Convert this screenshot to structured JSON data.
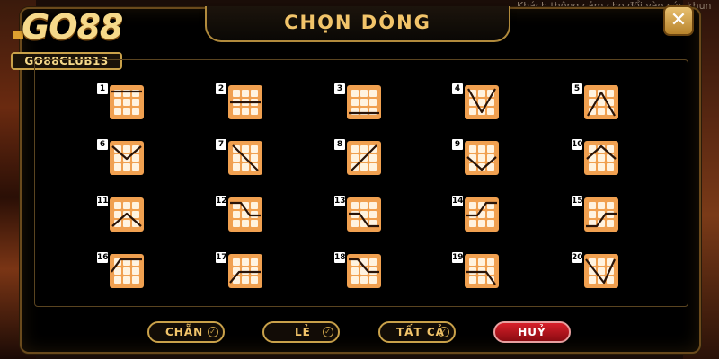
{
  "background": {
    "top_text": "Khách thông cảm cho đổi vào các khun"
  },
  "logo": {
    "main": "GO88",
    "sub": "GO88CLUB13"
  },
  "dialog": {
    "title": "CHỌN DÒNG",
    "close_label": "✕",
    "colors": {
      "accent": "#f2c46a",
      "icon_fill": "#f0a050",
      "line": "#2a1408",
      "frame": "#c9a14a"
    }
  },
  "lines": [
    {
      "number": "1",
      "pattern": "row-top"
    },
    {
      "number": "2",
      "pattern": "row-middle"
    },
    {
      "number": "3",
      "pattern": "row-bottom"
    },
    {
      "number": "4",
      "pattern": "v-down"
    },
    {
      "number": "5",
      "pattern": "v-up"
    },
    {
      "number": "6",
      "pattern": "v-down-small"
    },
    {
      "number": "7",
      "pattern": "diag-down"
    },
    {
      "number": "8",
      "pattern": "diag-up"
    },
    {
      "number": "9",
      "pattern": "v-low"
    },
    {
      "number": "10",
      "pattern": "v-up-small"
    },
    {
      "number": "11",
      "pattern": "v-up-bottom"
    },
    {
      "number": "12",
      "pattern": "step-down"
    },
    {
      "number": "13",
      "pattern": "step-down-low"
    },
    {
      "number": "14",
      "pattern": "step-up"
    },
    {
      "number": "15",
      "pattern": "step-up-low"
    },
    {
      "number": "16",
      "pattern": "step-up-top"
    },
    {
      "number": "17",
      "pattern": "step-up-mid"
    },
    {
      "number": "18",
      "pattern": "step-down-mid"
    },
    {
      "number": "19",
      "pattern": "step-down-bottom"
    },
    {
      "number": "20",
      "pattern": "v-down-right"
    }
  ],
  "buttons": {
    "even": "CHẴN",
    "odd": "LẺ",
    "all": "TẤT CẢ",
    "cancel": "HUỶ",
    "check_glyph": "✓"
  }
}
